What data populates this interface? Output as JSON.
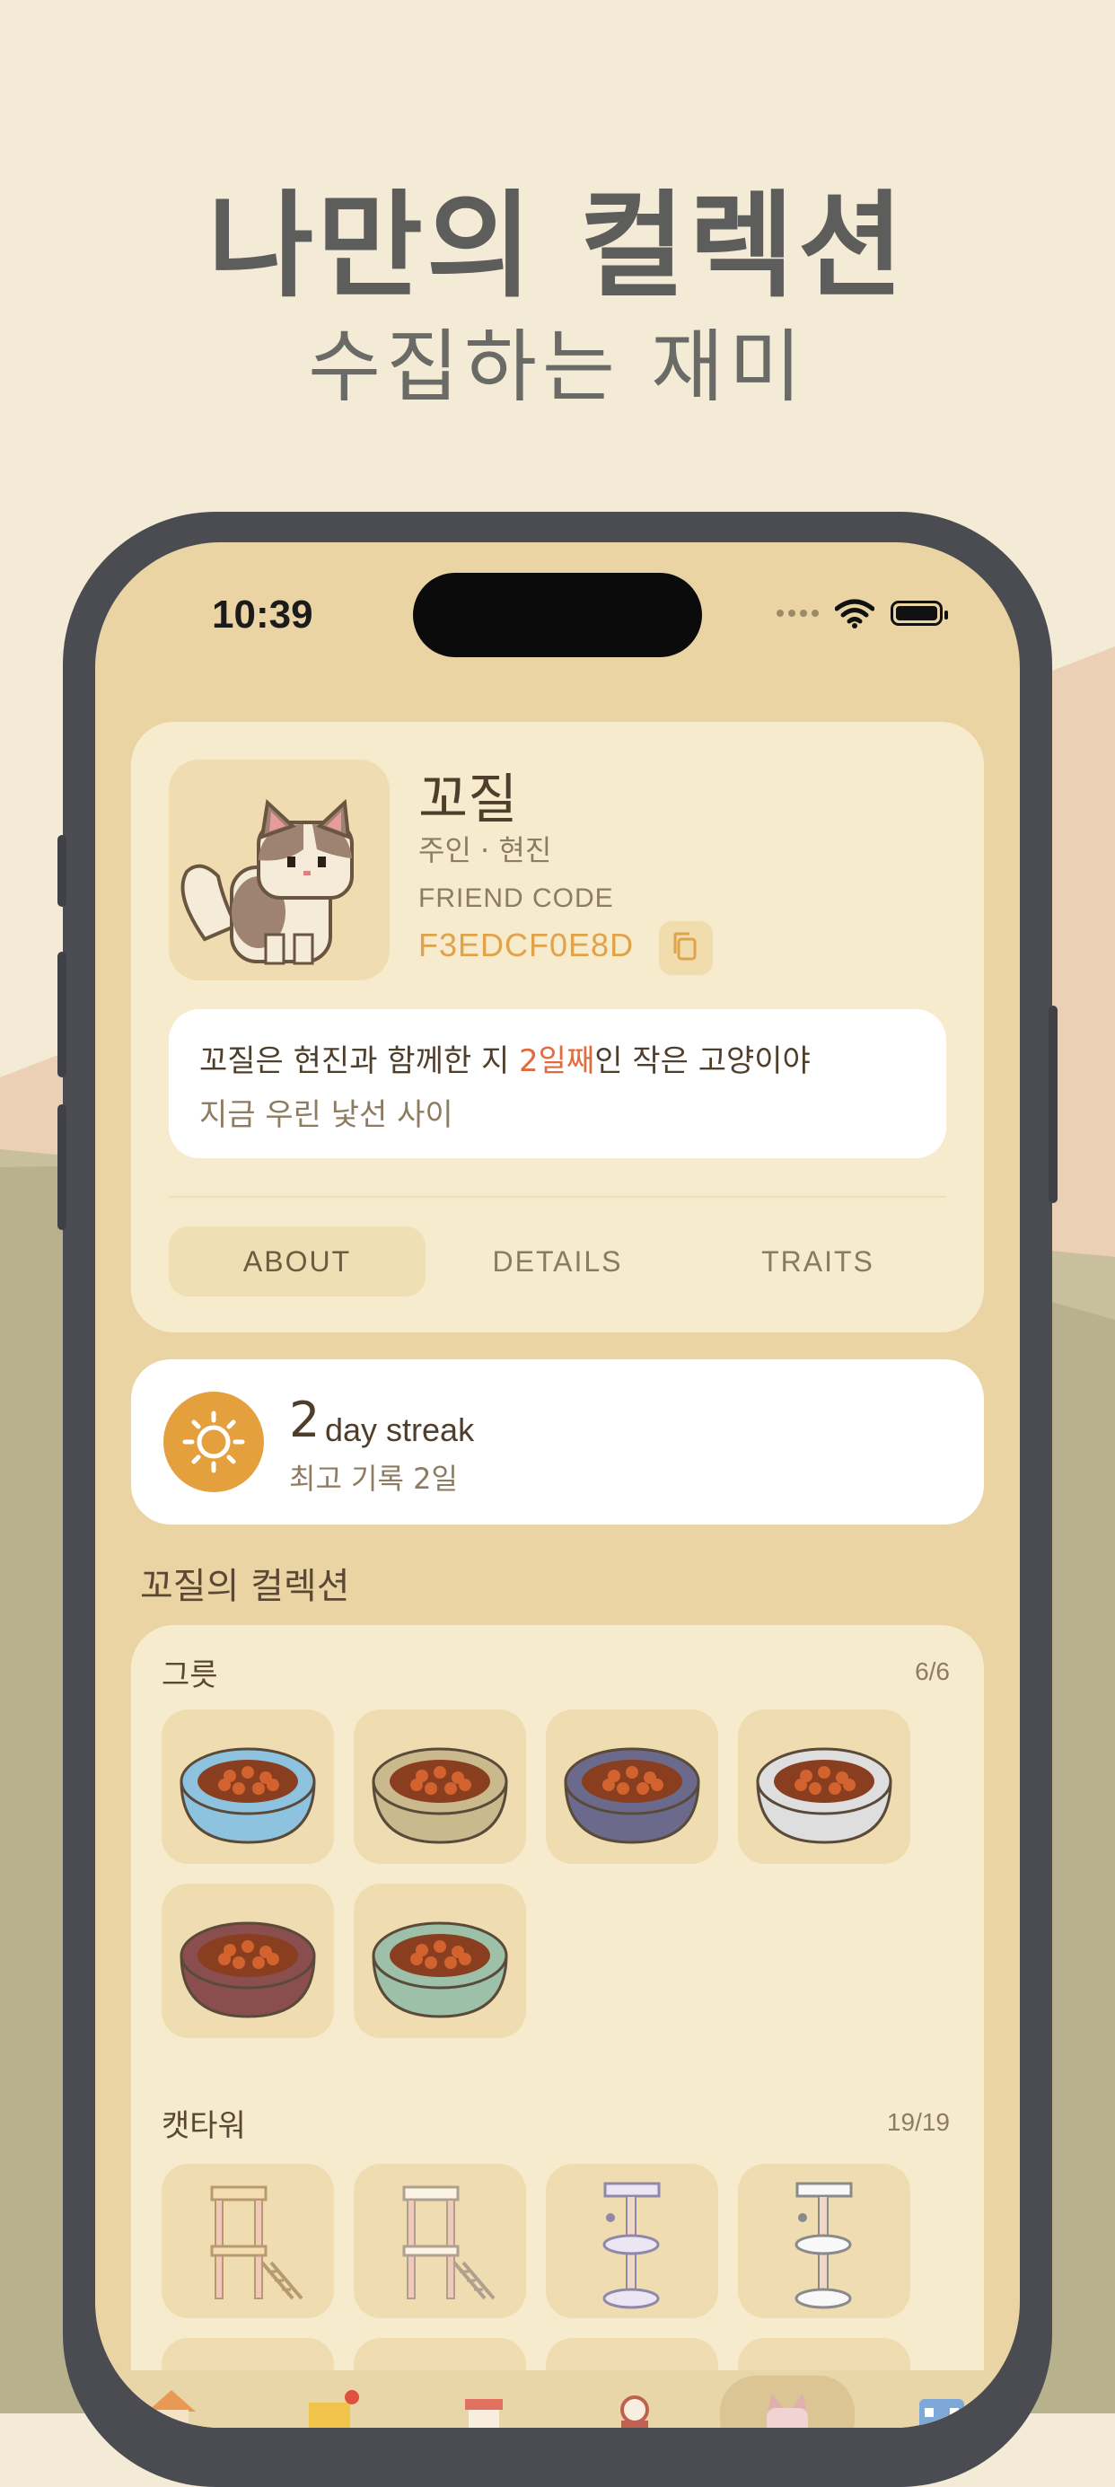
{
  "headline": {
    "title": "나만의 컬렉션",
    "subtitle": "수집하는 재미"
  },
  "status_bar": {
    "time": "10:39"
  },
  "profile": {
    "name": "꼬질",
    "owner_line": "주인 · 현진",
    "friend_code_label": "FRIEND CODE",
    "friend_code": "F3EDCF0E8D",
    "message_prefix": "꼬질은 현진과 함께한 지 ",
    "message_highlight": "2일째",
    "message_suffix": "인 작은 고양이야",
    "message_line2": "지금 우린 낯선 사이"
  },
  "tabs": {
    "about": "ABOUT",
    "details": "DETAILS",
    "traits": "TRAITS",
    "selected": "about"
  },
  "streak": {
    "count": "2",
    "label": "day streak",
    "best": "최고 기록 2일"
  },
  "collection": {
    "title": "꼬질의 컬렉션",
    "bowls": {
      "title": "그릇",
      "count": "6/6",
      "items": [
        {
          "name": "blue-bowl",
          "color": "#8ec3e0"
        },
        {
          "name": "beige-bowl",
          "color": "#c9b98c"
        },
        {
          "name": "purple-bowl",
          "color": "#6c6a8c"
        },
        {
          "name": "white-bowl",
          "color": "#dedede"
        },
        {
          "name": "maroon-bowl",
          "color": "#8a4e4e"
        },
        {
          "name": "mint-bowl",
          "color": "#9cc0a8"
        }
      ]
    },
    "cat_towers": {
      "title": "캣타워",
      "count": "19/19"
    }
  },
  "colors": {
    "background": "#f3ebd6",
    "screen": "#ead4a4",
    "card": "#f7ebcd",
    "accent_orange": "#e06b3e",
    "accent_gold": "#e3a03c",
    "text_dark": "#4f3e2c"
  },
  "nav": {
    "items": [
      "home-icon",
      "envelope-icon",
      "shop-icon",
      "game-icon",
      "cat-icon",
      "calendar-icon"
    ],
    "selected": "cat-icon"
  }
}
